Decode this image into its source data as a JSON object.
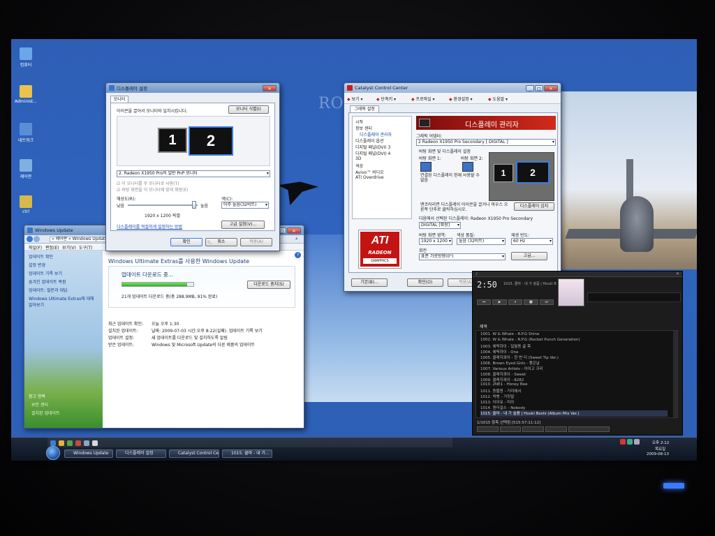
{
  "desktop": {
    "wallpaper_text": "RO",
    "icons": [
      {
        "label": "컴퓨터",
        "color": "#6aa6e8"
      },
      {
        "label": "Administ...",
        "color": "#e9c34e"
      },
      {
        "label": "네트워크",
        "color": "#5a8fd6"
      },
      {
        "label": "제어판",
        "color": "#7fb0e0"
      },
      {
        "label": "ctrl",
        "color": "#d8b84a"
      }
    ]
  },
  "display_dialog": {
    "title": "디스플레이 설정",
    "tab": "모니터",
    "instruction": "아이콘을 끌어서 모니터와 일치시킵니다.",
    "identify_button": "모니터 식별(I)",
    "monitor_1": "1",
    "monitor_2": "2",
    "monitor_select": "2. Radeon X1950 Pro의 일반 PnP 모니터",
    "checkbox_primary": "이 모니터를 주 모니터로 사용(T)",
    "checkbox_extend": "바탕 화면을 이 모니터에 맞게 확장(E)",
    "resolution_label": "해상도(R):",
    "low_label": "낮음",
    "high_label": "높음",
    "resolution_value": "1920 x 1200 픽셀",
    "color_label": "색(C):",
    "color_value": "아주 높음(32비트)",
    "help_link": "디스플레이를 적절하게 설정하는 방법",
    "advanced_button": "고급 설정(V)...",
    "ok_button": "확인",
    "cancel_button": "취소",
    "apply_button": "적용(A)"
  },
  "catalyst": {
    "title": "Catalyst Control Center",
    "toolbar": [
      "보기",
      "단축키",
      "프로파일",
      "환경설정",
      "도움말"
    ],
    "tab": "그래픽 설정",
    "tree": [
      "시작",
      "정보 센터",
      "디스플레이 관리자",
      "디스플레이 옵션",
      "디지털 패널(DVI) 3",
      "디지털 패널(DVI) 4",
      "3D",
      "색상",
      "Avivo™ 비디오",
      "ATI Overdrive"
    ],
    "header": "디스플레이 관리자",
    "adapter_label": "그래픽 어댑터:",
    "adapter_value": "2 Radeon X1950 Pro Secondary [ DIGITAL ]",
    "desktop_section": "바탕 화면 및 디스플레이 설정",
    "desktop1_label": "바탕 화면 1:",
    "desktop2_label": "바탕 화면 2:",
    "connected_note": "연결된 디스플레이 현재 사용할 수 없음",
    "mon_1": "1",
    "mon_2": "2",
    "hint": "맨코러리면 디스플레이 아이콘을 끌거나 마우스 오른쪽 단추로 클릭하십시오.",
    "detect_button": "디스플레이 감지",
    "selected_section": "다음에서 선택된 디스플레이: Radeon X1950 Pro Secondary",
    "digital_line": "DIGITAL    [확장]",
    "area_label": "바탕 화면 영역:",
    "area_value": "1920 x 1200",
    "color_label": "색상 품질:",
    "color_value": "높음 (32비트)",
    "refresh_label": "재생 빈도:",
    "refresh_value": "60 Hz",
    "rotation_label": "회전",
    "rotation_value": "표준 가로방향(0°)",
    "advanced_button": "고급...",
    "logo_top": "ATI",
    "logo_mid": "RADEON",
    "logo_bottom": "GRAPHICS",
    "basic_button": "기본(B)...",
    "ok_button": "확인(O)",
    "apply_button": "적용(A)"
  },
  "windows_update": {
    "title": "Windows Update",
    "address": "« 제어판 » Windows Update",
    "menu": [
      "파일(F)",
      "편집(E)",
      "보기(V)",
      "도구(T)"
    ],
    "side_links": [
      "업데이트 확인",
      "설정 변경",
      "업데이트 기록 보기",
      "숨겨진 업데이트 복원",
      "업데이트: 질문과 대답",
      "Windows Ultimate Extras에 대해 알아보기"
    ],
    "side_bottom": [
      "참고 항목",
      "보안 센터",
      "설치된 업데이트"
    ],
    "heading": "Windows Ultimate Extras를 사용한 Windows Update",
    "download_title": "업데이트 다운로드 중...",
    "stop_button": "다운로드 중지(S)",
    "progress": 0.91,
    "progress_text": "21개 업데이트 다운로드 중(총 288.9MB, 91% 완료)",
    "info": [
      {
        "k": "최근 업데이트 확인:",
        "v": "오늘 오후 1:30"
      },
      {
        "k": "설치된 업데이트:",
        "v": "날짜: 2009-07-03 시간:오후 8:22(실패). 업데이트 기록 보기"
      },
      {
        "k": "업데이트 설정:",
        "v": "새 업데이트를 다운로드 및 설치하도록 알림"
      },
      {
        "k": "받은 업데이트:",
        "v": "Windows 및 Microsoft Update의 다른 제품의 업데이트"
      }
    ]
  },
  "player": {
    "time": "2:50",
    "now_playing": "1015. 쿨마 - 내 가 슬픔 | Houki Boshi (Album Mix Ver.)",
    "list_header": "제목",
    "playlist": [
      "1001. W & Whale - R.P.G Shine",
      "1002. W & Whale - R.P.G (Rocket Punch Generation)",
      "1003. 에픽하이 - 일월동 굴 목",
      "1004. 에픽하이 - One",
      "1005. 클래지콰이 - 한 번 더 (Sweet Tip Ver.)",
      "1006. Brown Eyed Girls - 좋은날",
      "1007. Various Artists - 아이고 크리",
      "1008. 클래지콰이 - Sweet",
      "1009. 클래지콰이 - 8282",
      "1010. 2NE1 - Honey Bee",
      "1011. 동물원 - 거리에서",
      "1012. 빅뱅 - 거짓말",
      "1013. 아이유 - 미아",
      "1014. 원더걸스 - Nobody",
      "1015. 쿨마 - 내 가 슬픔 | Houki Boshi (Album Mix Ver.)"
    ],
    "status": "1/1015 항목 선택됨 [515:57:11:12]"
  },
  "taskbar": {
    "items": [
      "Windows Update",
      "디스플레이 설정",
      "Catalyst Control Ce...",
      "1015. 쿨마 - 내 가..."
    ],
    "clock_time": "오후 2:12",
    "clock_day": "목요일",
    "clock_date": "2009-08-13"
  }
}
